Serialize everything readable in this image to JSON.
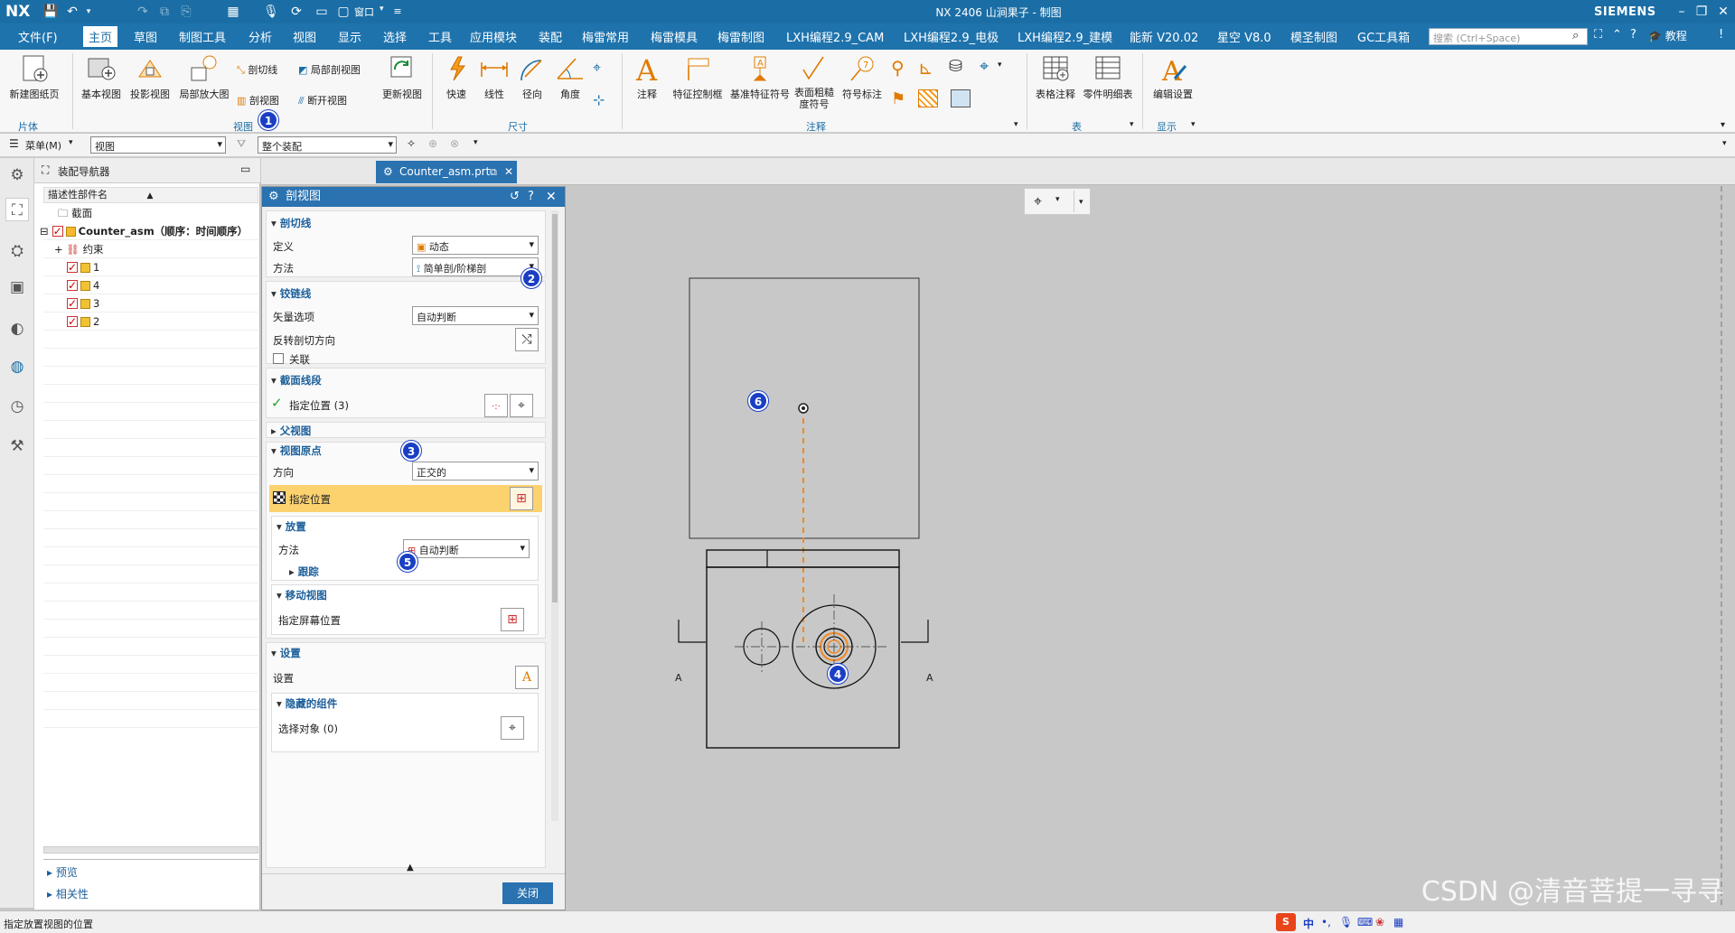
{
  "titlebar": {
    "logo": "NX",
    "window_title": "NX 2406 山涧果子 - 制图",
    "window_menu": "窗口",
    "brand": "SIEMENS"
  },
  "menubar": {
    "file": "文件(F)",
    "tabs": [
      "主页",
      "草图",
      "制图工具",
      "分析",
      "视图",
      "显示",
      "选择",
      "工具",
      "应用模块",
      "装配",
      "梅雷常用",
      "梅雷模具",
      "梅雷制图",
      "LXH编程2.9_CAM",
      "LXH编程2.9_电极",
      "LXH编程2.9_建模",
      "能新 V20.02",
      "星空 V8.0",
      "模圣制图",
      "GC工具箱"
    ],
    "search_placeholder": "搜索 (Ctrl+Space)",
    "tutorial": "教程"
  },
  "ribbon": {
    "new_sheet": "新建图纸页",
    "base_view": "基本视图",
    "projected_view": "投影视图",
    "detail_view": "局部放大图",
    "section_line": "剖切线",
    "section_view": "剖视图",
    "break_out_section": "局部剖视图",
    "broken_view": "断开视图",
    "update_view": "更新视图",
    "rapid": "快速",
    "linear": "线性",
    "radial": "径向",
    "angular": "角度",
    "note": "注释",
    "feature_control_frame": "特征控制框",
    "datum_feature_symbol": "基准特征符号",
    "surface_finish_symbol": "表面粗糙度符号",
    "symbol_label": "符号标注",
    "tabular_note": "表格注释",
    "parts_list": "零件明细表",
    "edit_settings": "编辑设置",
    "group_sheet": "片体",
    "group_view": "视图",
    "group_dimension": "尺寸",
    "group_annotation": "注释",
    "group_table": "表",
    "group_display": "显示"
  },
  "toolbar2": {
    "menu": "菜单(M)",
    "filter_view": "视图",
    "assembly_scope": "整个装配"
  },
  "navigator": {
    "title": "装配导航器",
    "column": "描述性部件名",
    "sections": "截面",
    "root": "Counter_asm（顺序：时间顺序）",
    "constraints": "约束",
    "parts": [
      "1",
      "4",
      "3",
      "2"
    ],
    "preview": "预览",
    "dependencies": "相关性"
  },
  "doc_tab": "Counter_asm.prt",
  "dialog": {
    "title": "剖视图",
    "section_line": "剖切线",
    "definition_label": "定义",
    "definition_value": "动态",
    "method_label": "方法",
    "method_value": "简单剖/阶梯剖",
    "hinge_line": "铰链线",
    "vector_option_label": "矢量选项",
    "vector_option_value": "自动判断",
    "reverse_direction": "反转剖切方向",
    "associative": "关联",
    "section_segments": "截面线段",
    "specify_location_3": "指定位置 (3)",
    "parent_view": "父视图",
    "view_origin": "视图原点",
    "orientation_label": "方向",
    "orientation_value": "正交的",
    "specify_location": "指定位置",
    "placement": "放置",
    "placement_method_label": "方法",
    "placement_method_value": "自动判断",
    "tracking": "跟踪",
    "move_view": "移动视图",
    "specify_screen_location": "指定屏幕位置",
    "settings": "设置",
    "settings_label": "设置",
    "hidden_components": "隐藏的组件",
    "select_objects": "选择对象 (0)",
    "close": "关闭"
  },
  "markers": [
    "1",
    "2",
    "3",
    "4",
    "5",
    "6"
  ],
  "drawing": {
    "label_left": "A",
    "label_right": "A"
  },
  "status": "指定放置视图的位置",
  "watermark": "CSDN @清音菩提一寻寻",
  "colors": {
    "title_blue": "#1b6ea5",
    "dialog_blue": "#2a72b0",
    "highlight": "#fcd26f",
    "marker": "#1a3fc4",
    "section_dash": "#f08a24"
  }
}
